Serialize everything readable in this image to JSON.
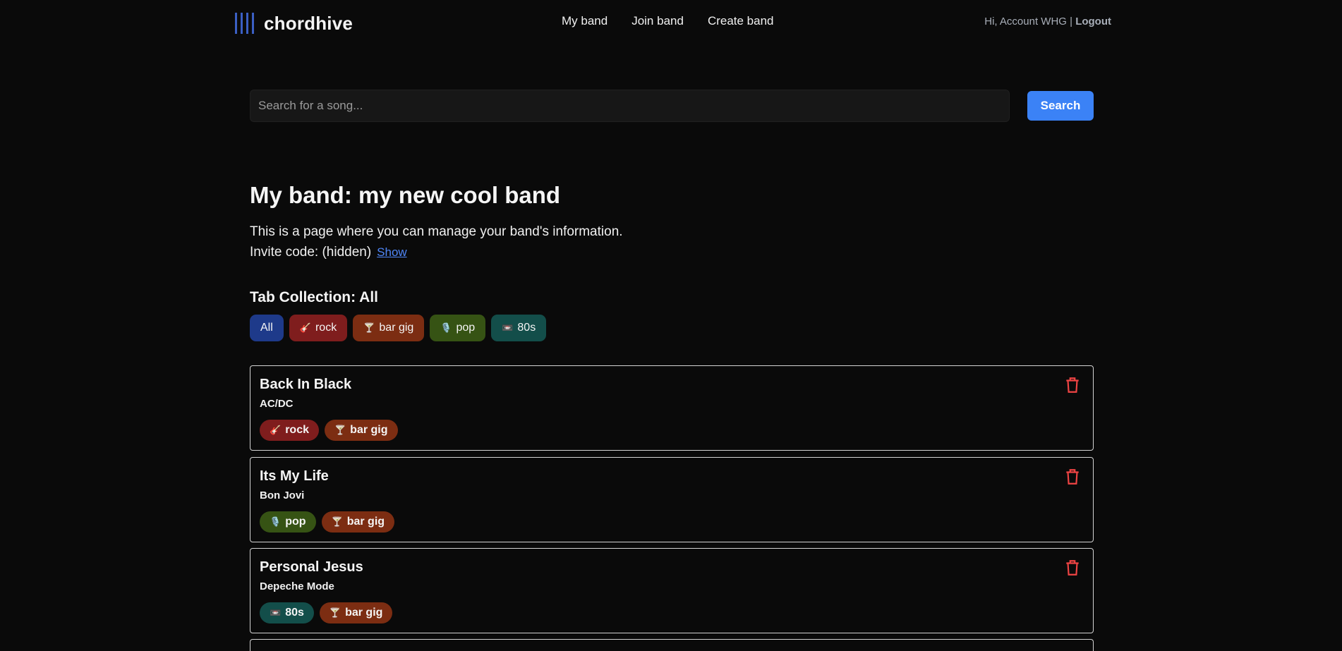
{
  "header": {
    "brand": "chordhive",
    "nav": [
      "My band",
      "Join band",
      "Create band"
    ],
    "greeting": "Hi, Account WHG |",
    "logout": "Logout"
  },
  "search": {
    "placeholder": "Search for a song...",
    "button": "Search"
  },
  "band": {
    "title": "My band: my new cool band",
    "description": "This is a page where you can manage your band's information.",
    "invite_label": "Invite code: (hidden)",
    "show_link": "Show"
  },
  "collection": {
    "title": "Tab Collection: All",
    "filters": [
      {
        "label": "All",
        "icon": ""
      },
      {
        "label": "rock",
        "icon": "🎸"
      },
      {
        "label": "bar gig",
        "icon": "🍸"
      },
      {
        "label": "pop",
        "icon": "🎙️"
      },
      {
        "label": "80s",
        "icon": "📼"
      }
    ]
  },
  "songs": [
    {
      "title": "Back In Black",
      "artist": "AC/DC",
      "tags": [
        {
          "label": "rock",
          "icon": "🎸"
        },
        {
          "label": "bar gig",
          "icon": "🍸"
        }
      ]
    },
    {
      "title": "Its My Life",
      "artist": "Bon Jovi",
      "tags": [
        {
          "label": "pop",
          "icon": "🎙️"
        },
        {
          "label": "bar gig",
          "icon": "🍸"
        }
      ]
    },
    {
      "title": "Personal Jesus",
      "artist": "Depeche Mode",
      "tags": [
        {
          "label": "80s",
          "icon": "📼"
        },
        {
          "label": "bar gig",
          "icon": "🍸"
        }
      ]
    }
  ],
  "colors": {
    "accent": "#3b82f6",
    "delete": "#ef4444",
    "tag_rock": "#7f1d1d",
    "tag_bar_gig": "#7c2d12",
    "tag_pop": "#365314",
    "tag_80s": "#134e4a",
    "tag_all": "#1e3a8a"
  }
}
